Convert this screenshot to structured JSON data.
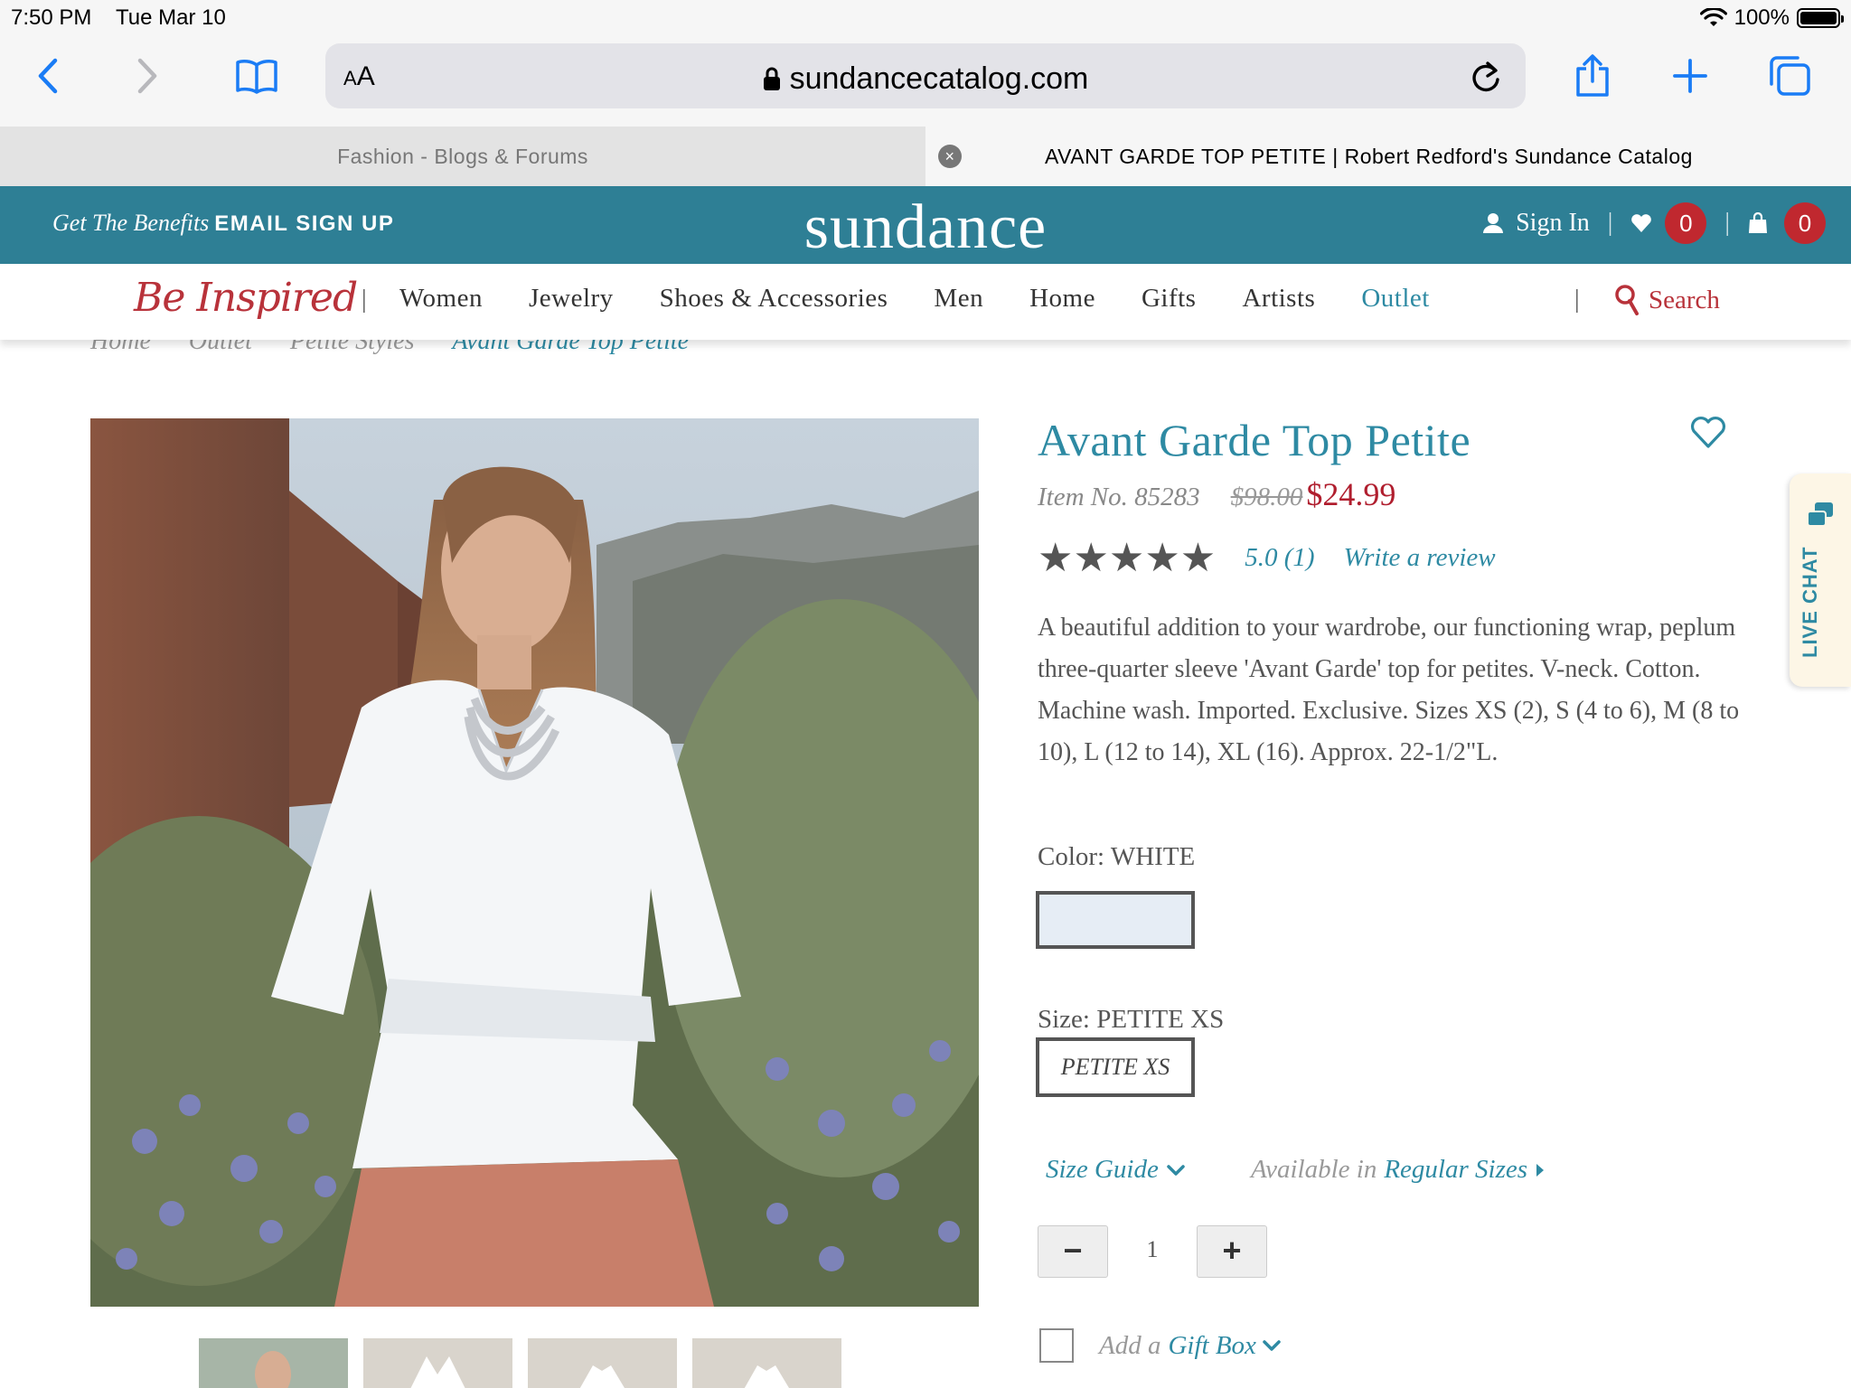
{
  "status_bar": {
    "time": "7:50 PM",
    "date": "Tue Mar 10",
    "battery": "100%"
  },
  "browser": {
    "aa_label": "AA",
    "url": "sundancecatalog.com",
    "tabs": [
      {
        "title": "Fashion - Blogs & Forums",
        "active": false
      },
      {
        "title": "AVANT GARDE TOP PETITE | Robert Redford's Sundance Catalog",
        "active": true
      }
    ]
  },
  "site": {
    "promo_italic": "Get The Benefits",
    "promo_cta": "EMAIL SIGN UP",
    "logo": "sundance",
    "sign_in": "Sign In",
    "wishlist_count": "0",
    "cart_count": "0",
    "be_inspired": "Be Inspired",
    "nav": [
      "Women",
      "Jewelry",
      "Shoes & Accessories",
      "Men",
      "Home",
      "Gifts",
      "Artists",
      "Outlet"
    ],
    "search_label": "Search",
    "accent": "#2e7f95",
    "sale_color": "#b01e2e"
  },
  "breadcrumb": [
    "Home",
    "Outlet",
    "Petite Styles",
    "Avant Garde Top Petite"
  ],
  "product": {
    "name": "Avant Garde Top Petite",
    "item_no": "Item No. 85283",
    "was_price": "$98.00",
    "price": "$24.99",
    "stars": "★★★★★",
    "rating": "5.0 (1)",
    "write_review": "Write a review",
    "description": "A beautiful addition to your wardrobe, our functioning wrap, peplum three-quarter sleeve 'Avant Garde' top for petites. V-neck. Cotton. Machine wash. Imported. Exclusive. Sizes XS (2), S (4 to 6), M (8 to 10), L (12 to 14), XL (16). Approx. 22-1/2\"L.",
    "color_label": "Color: WHITE",
    "size_label": "Size: PETITE XS",
    "size_option": "PETITE XS",
    "size_guide": "Size Guide",
    "available_in": "Available in",
    "regular_sizes": "Regular Sizes",
    "quantity": "1",
    "minus": "−",
    "plus": "+",
    "gift_add": "Add a",
    "gift_box": "Gift Box"
  },
  "live_chat": "LIVE CHAT"
}
